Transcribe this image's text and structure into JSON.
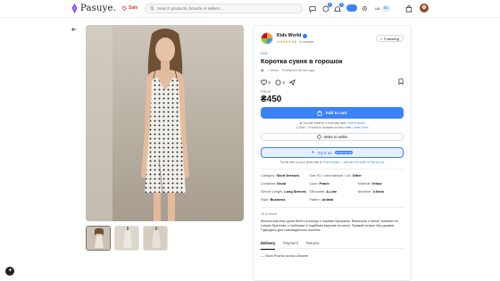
{
  "header": {
    "brand": "Pasuye.",
    "sale_label": "Sale",
    "search_placeholder": "Search products, brands or sellers...",
    "notif_badge_1": "1",
    "notif_badge_2": "2",
    "toggle_label": "",
    "lang_code": "UA",
    "lang_flag": "EN"
  },
  "seller": {
    "name": "Kids World",
    "rating_text": "4.6 · 4 reviews",
    "follow_label": "Following"
  },
  "product": {
    "category": "Kids",
    "title": "Коротка сукня в горошок",
    "views": "7 views",
    "published": "Published 45 min ago",
    "likes": "0",
    "comments": "3",
    "price_label": "PRICE",
    "price": "₴450",
    "cart_label": "Add to cart",
    "note_line1_pre": "You can reserve 4-hold pay later.",
    "note_line1_link": "How it works",
    "note_line2_pre": "Earn ~% back in bonuses on this order.",
    "note_line2_link": "Learn more",
    "write_label": "Write to seller",
    "tryon_label": "Try it on",
    "tryon_badge": "Experimental",
    "tryon_note_pre": "Try the item on your photo with AI",
    "tryon_note_link1": "How it works",
    "tryon_note_mid": "— and who it's worth it?",
    "tryon_note_link2": "My try-ons",
    "attributes": [
      {
        "k": "Category:",
        "v": "Short Dresses",
        "wide": false
      },
      {
        "k": "Size EU / International / UA:",
        "v": "Other",
        "wide": true
      },
      {
        "k": "Condition:",
        "v": "Good",
        "wide": false
      },
      {
        "k": "Color:",
        "v": "Peach",
        "wide": false
      },
      {
        "k": "Material:",
        "v": "Velour",
        "wide": false
      },
      {
        "k": "Sleeve Length:",
        "v": "Long Sleeves",
        "wide": false
      },
      {
        "k": "Silhouette:",
        "v": "A-Line",
        "wide": false
      },
      {
        "k": "Neckline:",
        "v": "V-Neck",
        "wide": false
      },
      {
        "k": "Style:",
        "v": "Business",
        "wide": false
      },
      {
        "k": "Pattern:",
        "v": "Animal",
        "wide": false
      }
    ],
    "stock": "19 in stock",
    "description": "Жіноча коротка сукня білого кольору з чорним горошком. Виконана з легкої тканини на тонких бретелях з глибоким V-подібним вирізом на спині. Прямий силует без рукавів. Підходить для повсякденного носіння.",
    "tabs": [
      "Delivery",
      "Payment",
      "Returns"
    ],
    "delivery_line": "— Nova Poshta across Ukraine"
  },
  "colors": {
    "accent": "#3b82f6",
    "sale": "#e03a2e",
    "text": "#111111"
  }
}
